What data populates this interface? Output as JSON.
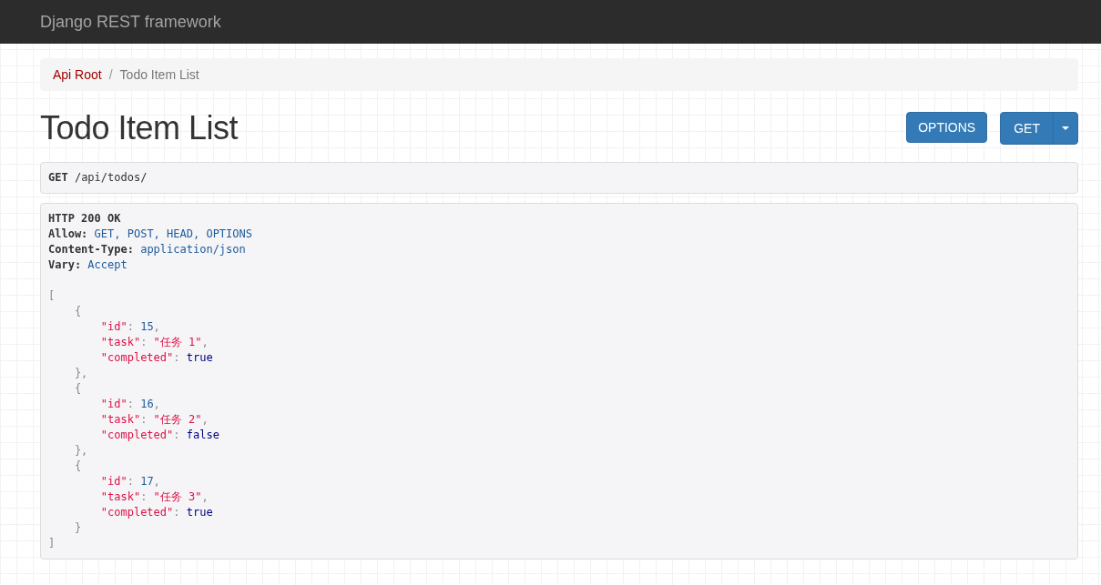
{
  "navbar": {
    "brand": "Django REST framework"
  },
  "breadcrumb": [
    {
      "label": "Api Root",
      "selected": false
    },
    {
      "label": "Todo Item List",
      "selected": true
    }
  ],
  "breadcrumb_separator": "/",
  "page_title": "Todo Item List",
  "buttons": [
    {
      "label": "OPTIONS",
      "kind": "plain"
    },
    {
      "label": "GET",
      "kind": "split"
    }
  ],
  "request": {
    "method": "GET",
    "path": "/api/todos/"
  },
  "response": {
    "status": "HTTP 200 OK",
    "headers": [
      {
        "name": "Allow:",
        "value": "GET, POST, HEAD, OPTIONS"
      },
      {
        "name": "Content-Type:",
        "value": "application/json"
      },
      {
        "name": "Vary:",
        "value": "Accept"
      }
    ],
    "body_lines": [
      [
        {
          "text": "[",
          "kind": "pun"
        }
      ],
      [
        {
          "text": "    {",
          "kind": "pun"
        }
      ],
      [
        {
          "text": "        \"id\"",
          "kind": "key"
        },
        {
          "text": ": ",
          "kind": "pun"
        },
        {
          "text": "15",
          "kind": "num"
        },
        {
          "text": ",",
          "kind": "pun"
        }
      ],
      [
        {
          "text": "        \"task\"",
          "kind": "key"
        },
        {
          "text": ": ",
          "kind": "pun"
        },
        {
          "text": "\"任务 1\"",
          "kind": "str"
        },
        {
          "text": ",",
          "kind": "pun"
        }
      ],
      [
        {
          "text": "        \"completed\"",
          "kind": "key"
        },
        {
          "text": ": ",
          "kind": "pun"
        },
        {
          "text": "true",
          "kind": "lit"
        }
      ],
      [
        {
          "text": "    },",
          "kind": "pun"
        }
      ],
      [
        {
          "text": "    {",
          "kind": "pun"
        }
      ],
      [
        {
          "text": "        \"id\"",
          "kind": "key"
        },
        {
          "text": ": ",
          "kind": "pun"
        },
        {
          "text": "16",
          "kind": "num"
        },
        {
          "text": ",",
          "kind": "pun"
        }
      ],
      [
        {
          "text": "        \"task\"",
          "kind": "key"
        },
        {
          "text": ": ",
          "kind": "pun"
        },
        {
          "text": "\"任务 2\"",
          "kind": "str"
        },
        {
          "text": ",",
          "kind": "pun"
        }
      ],
      [
        {
          "text": "        \"completed\"",
          "kind": "key"
        },
        {
          "text": ": ",
          "kind": "pun"
        },
        {
          "text": "false",
          "kind": "lit"
        }
      ],
      [
        {
          "text": "    },",
          "kind": "pun"
        }
      ],
      [
        {
          "text": "    {",
          "kind": "pun"
        }
      ],
      [
        {
          "text": "        \"id\"",
          "kind": "key"
        },
        {
          "text": ": ",
          "kind": "pun"
        },
        {
          "text": "17",
          "kind": "num"
        },
        {
          "text": ",",
          "kind": "pun"
        }
      ],
      [
        {
          "text": "        \"task\"",
          "kind": "key"
        },
        {
          "text": ": ",
          "kind": "pun"
        },
        {
          "text": "\"任务 3\"",
          "kind": "str"
        },
        {
          "text": ",",
          "kind": "pun"
        }
      ],
      [
        {
          "text": "        \"completed\"",
          "kind": "key"
        },
        {
          "text": ": ",
          "kind": "pun"
        },
        {
          "text": "true",
          "kind": "lit"
        }
      ],
      [
        {
          "text": "    }",
          "kind": "pun"
        }
      ],
      [
        {
          "text": "]",
          "kind": "pun"
        }
      ]
    ]
  }
}
